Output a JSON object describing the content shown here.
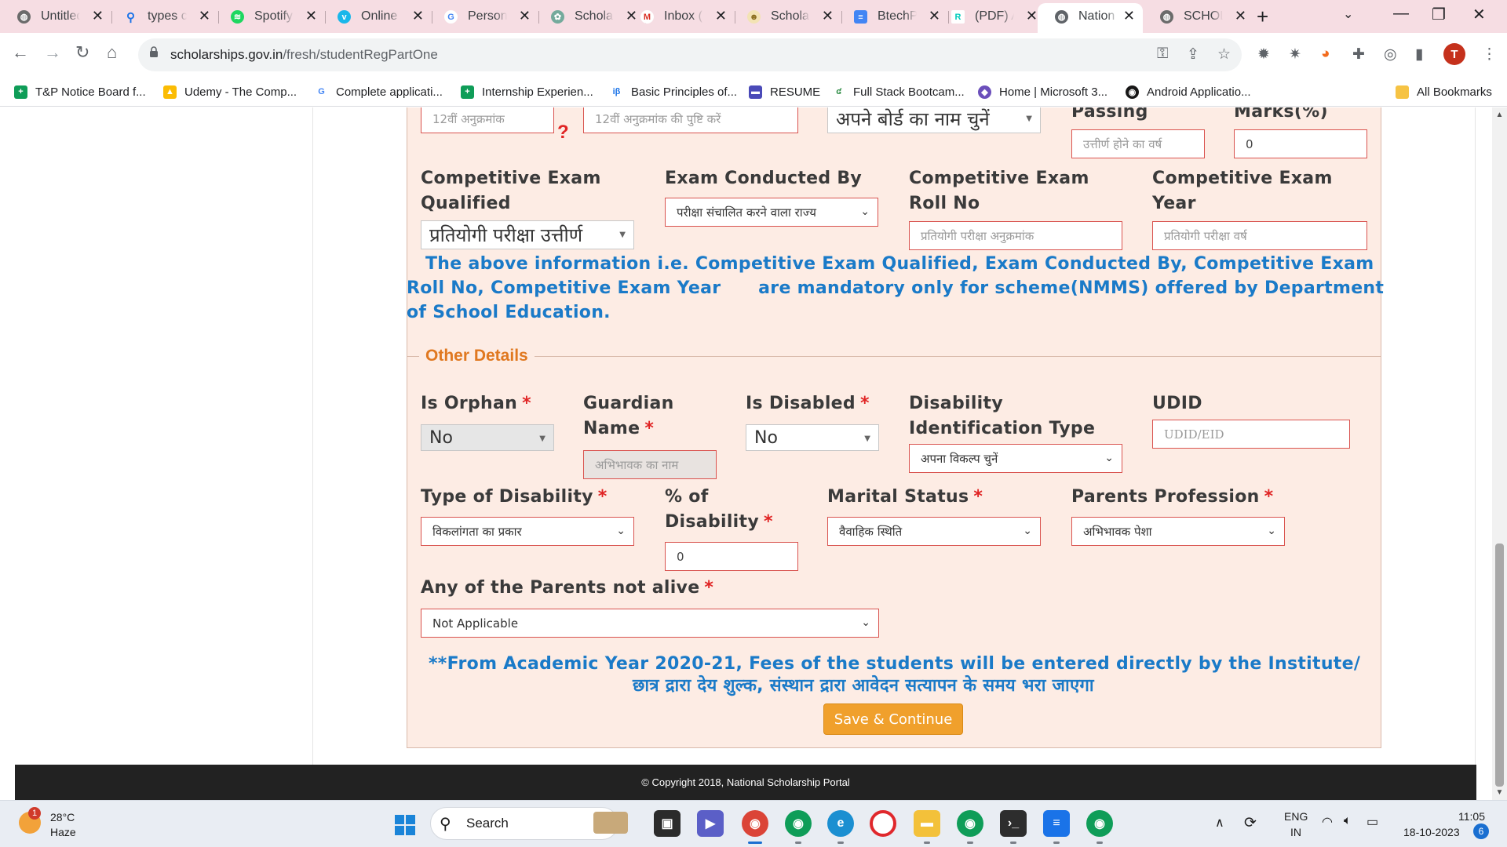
{
  "colors": {
    "tab_strip": "#f6dde3",
    "panel_background": "#fdece4",
    "section_legend": "#e07820",
    "required_marker": "#e02424",
    "notice_text": "#1a7ac8",
    "primary_button": "#f0a02c",
    "footer": "#222222"
  },
  "browser": {
    "tabs": [
      {
        "title": "Untitled",
        "icon": "globe-icon",
        "active": false
      },
      {
        "title": "types c",
        "icon": "search-icon",
        "active": false
      },
      {
        "title": "Spotify",
        "icon": "spotify-icon",
        "active": false
      },
      {
        "title": "Online",
        "icon": "vimeo-icon",
        "active": false
      },
      {
        "title": "Person",
        "icon": "google-icon",
        "active": false
      },
      {
        "title": "Schola",
        "icon": "openai-icon",
        "active": false
      },
      {
        "title": "Inbox (",
        "icon": "gmail-icon",
        "active": false
      },
      {
        "title": "Schola",
        "icon": "scholar-icon",
        "active": false
      },
      {
        "title": "BtechP",
        "icon": "docs-icon",
        "active": false
      },
      {
        "title": "(PDF) A",
        "icon": "researchgate-icon",
        "active": false
      },
      {
        "title": "Nation",
        "icon": "globe-icon",
        "active": true
      },
      {
        "title": "SCHOL",
        "icon": "globe-icon",
        "active": false
      }
    ],
    "new_tab_label": "+",
    "url_domain": "scholarships.gov.in",
    "url_path": "/fresh/studentRegPartOne",
    "profile_initial": "T",
    "bookmarks": [
      {
        "label": "T&P Notice Board f...",
        "icon": "sheets-icon"
      },
      {
        "label": "Udemy - The Comp...",
        "icon": "drive-icon"
      },
      {
        "label": "Complete applicati...",
        "icon": "google-icon"
      },
      {
        "label": "Internship Experien...",
        "icon": "sheets-icon"
      },
      {
        "label": "Basic Principles of...",
        "icon": "ib-icon"
      },
      {
        "label": "RESUME",
        "icon": "resume-icon"
      },
      {
        "label": "Full Stack Bootcam...",
        "icon": "gfg-icon"
      },
      {
        "label": "Home | Microsoft 3...",
        "icon": "m365-icon"
      },
      {
        "label": "Android Applicatio...",
        "icon": "github-icon"
      }
    ],
    "bookmarks_overflow": "»",
    "all_bookmarks_label": "All Bookmarks"
  },
  "form": {
    "top_row": {
      "roll_no_placeholder": "12वीं अनुक्रमांक",
      "roll_confirm_placeholder": "12वीं अनुक्रमांक की पुष्टि करें",
      "board_select": "अपने बोर्ड का नाम चुनें",
      "passing_label": "Passing",
      "passing_placeholder": "उत्तीर्ण होने का वर्ष",
      "marks_label": "Marks(%)",
      "marks_value": "0",
      "help_mark": "?"
    },
    "competitive": {
      "qualified_label_1": "Competitive Exam",
      "qualified_label_2": "Qualified",
      "qualified_select": "प्रतियोगी परीक्षा उत्तीर्ण",
      "conducted_label": "Exam Conducted By",
      "conducted_select": "परीक्षा संचालित करने वाला राज्य",
      "roll_label_1": "Competitive Exam",
      "roll_label_2": "Roll No",
      "roll_placeholder": "प्रतियोगी परीक्षा अनुक्रमांक",
      "year_label_1": "Competitive Exam",
      "year_label_2": "Year",
      "year_placeholder": "प्रतियोगी परीक्षा वर्ष"
    },
    "notice_lines": [
      "The above information i.e. Competitive Exam Qualified, Exam Conducted By, Competitive Exam",
      "Roll No, Competitive Exam Year      are mandatory only for scheme(NMMS) offered by Department",
      "of School Education."
    ],
    "other_details": {
      "legend": "Other Details",
      "required_marker": "*",
      "orphan_label": "Is Orphan",
      "orphan_value": "No",
      "guardian_label_1": "Guardian",
      "guardian_label_2": "Name",
      "guardian_placeholder": "अभिभावक का नाम",
      "disabled_label": "Is Disabled",
      "disabled_value": "No",
      "disability_id_label_1": "Disability",
      "disability_id_label_2": "Identification Type",
      "disability_id_select": "अपना विकल्प चुनें",
      "udid_label": "UDID",
      "udid_placeholder": "UDID/EID",
      "disability_type_label": "Type of Disability",
      "disability_type_select": "विकलांगता का प्रकार",
      "disability_pct_label_1": "% of",
      "disability_pct_label_2": "Disability",
      "disability_pct_value": "0",
      "marital_label": "Marital Status",
      "marital_select": "वैवाहिक स्थिति",
      "parents_prof_label": "Parents Profession",
      "parents_prof_select": "अभिभावक पेशा",
      "parents_alive_label": "Any of the Parents not alive",
      "parents_alive_select": "Not Applicable"
    },
    "fee_note_line1": "**From Academic Year 2020-21, Fees of the students will be entered directly by the Institute/",
    "fee_note_line2": "छात्र द्रारा देय शुल्क, संस्थान द्रारा आवेदन सत्यापन के समय भरा जाएगा",
    "save_button": "Save & Continue",
    "footer": "© Copyright 2018, National Scholarship Portal"
  },
  "taskbar": {
    "weather_temp": "28°C",
    "weather_condition": "Haze",
    "weather_badge": "1",
    "search_label": "Search",
    "lang_1": "ENG",
    "lang_2": "IN",
    "time": "11:05",
    "date": "18-10-2023",
    "notification_count": "6"
  }
}
